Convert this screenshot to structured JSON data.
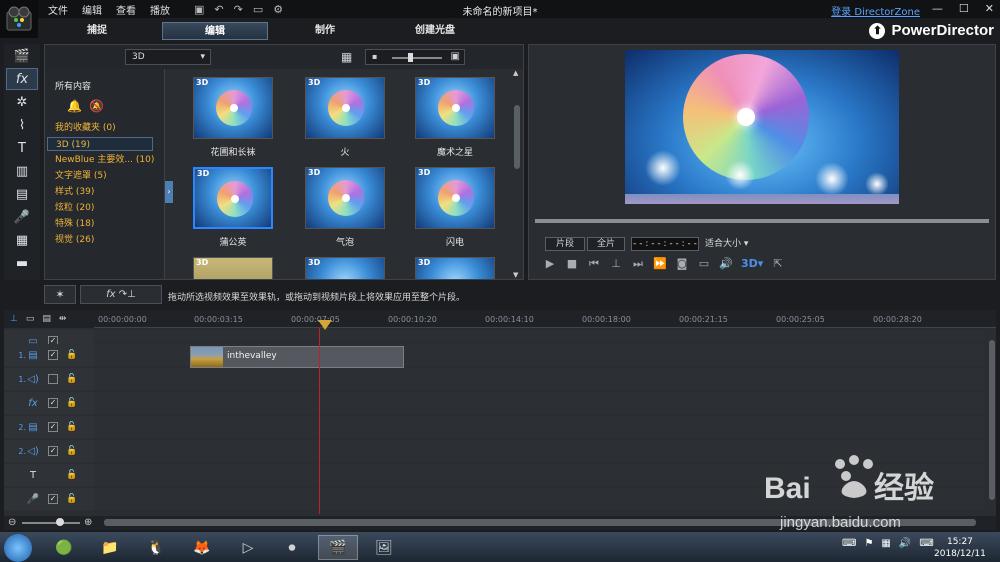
{
  "menu": [
    "文件",
    "编辑",
    "查看",
    "播放"
  ],
  "window_title": "未命名的新项目*",
  "login_link": "登录 DirectorZone",
  "mode_tabs": [
    "捕捉",
    "编辑",
    "制作",
    "创建光盘"
  ],
  "brand": "PowerDirector",
  "library": {
    "category": "3D",
    "folder_title": "所有内容",
    "folders": [
      "我的收藏夹 (0)",
      "3D (19)",
      "NewBlue 主要效... (10)",
      "文字遮罩 (5)",
      "样式 (39)",
      "炫粒 (20)",
      "特殊 (18)",
      "视觉 (26)"
    ],
    "thumbs": [
      {
        "badge": "3D",
        "label": "花圃和长袜"
      },
      {
        "badge": "3D",
        "label": "火"
      },
      {
        "badge": "3D",
        "label": "魔术之星"
      },
      {
        "badge": "3D",
        "label": "蒲公英"
      },
      {
        "badge": "3D",
        "label": "气泡"
      },
      {
        "badge": "3D",
        "label": "闪电"
      },
      {
        "badge": "3D",
        "label": ""
      },
      {
        "badge": "3D",
        "label": ""
      },
      {
        "badge": "3D",
        "label": ""
      }
    ]
  },
  "preview": {
    "clip_btn": "片段",
    "movie_btn": "全片",
    "timecode": "- - : - - : - - : - -",
    "fit": "适合大小"
  },
  "fxbar": {
    "apply_label": "fx",
    "hint": "拖动所选视频效果至效果轨，或拖动到视频片段上将效果应用至整个片段。"
  },
  "timeline": {
    "ruler": [
      "00:00:00:00",
      "00:00:03:15",
      "00:00:07:05",
      "00:00:10:20",
      "00:00:14:10",
      "00:00:18:00",
      "00:00:21:15",
      "00:00:25:05",
      "00:00:28:20"
    ],
    "clip_name": "inthevalley",
    "tracks": [
      {
        "num": "1.",
        "icon": "video"
      },
      {
        "num": "1.",
        "icon": "audio"
      },
      {
        "num": "",
        "icon": "fx"
      },
      {
        "num": "2.",
        "icon": "video"
      },
      {
        "num": "2.",
        "icon": "audio"
      },
      {
        "num": "",
        "icon": "title"
      },
      {
        "num": "",
        "icon": "voice"
      }
    ]
  },
  "taskbar": {
    "time": "15:27",
    "date": "2018/12/11"
  },
  "watermark": "jingyan.baidu.com",
  "colors": {
    "accent": "#2c86ff",
    "folder_text": "#f0b33b",
    "playhead": "#c0202a"
  }
}
